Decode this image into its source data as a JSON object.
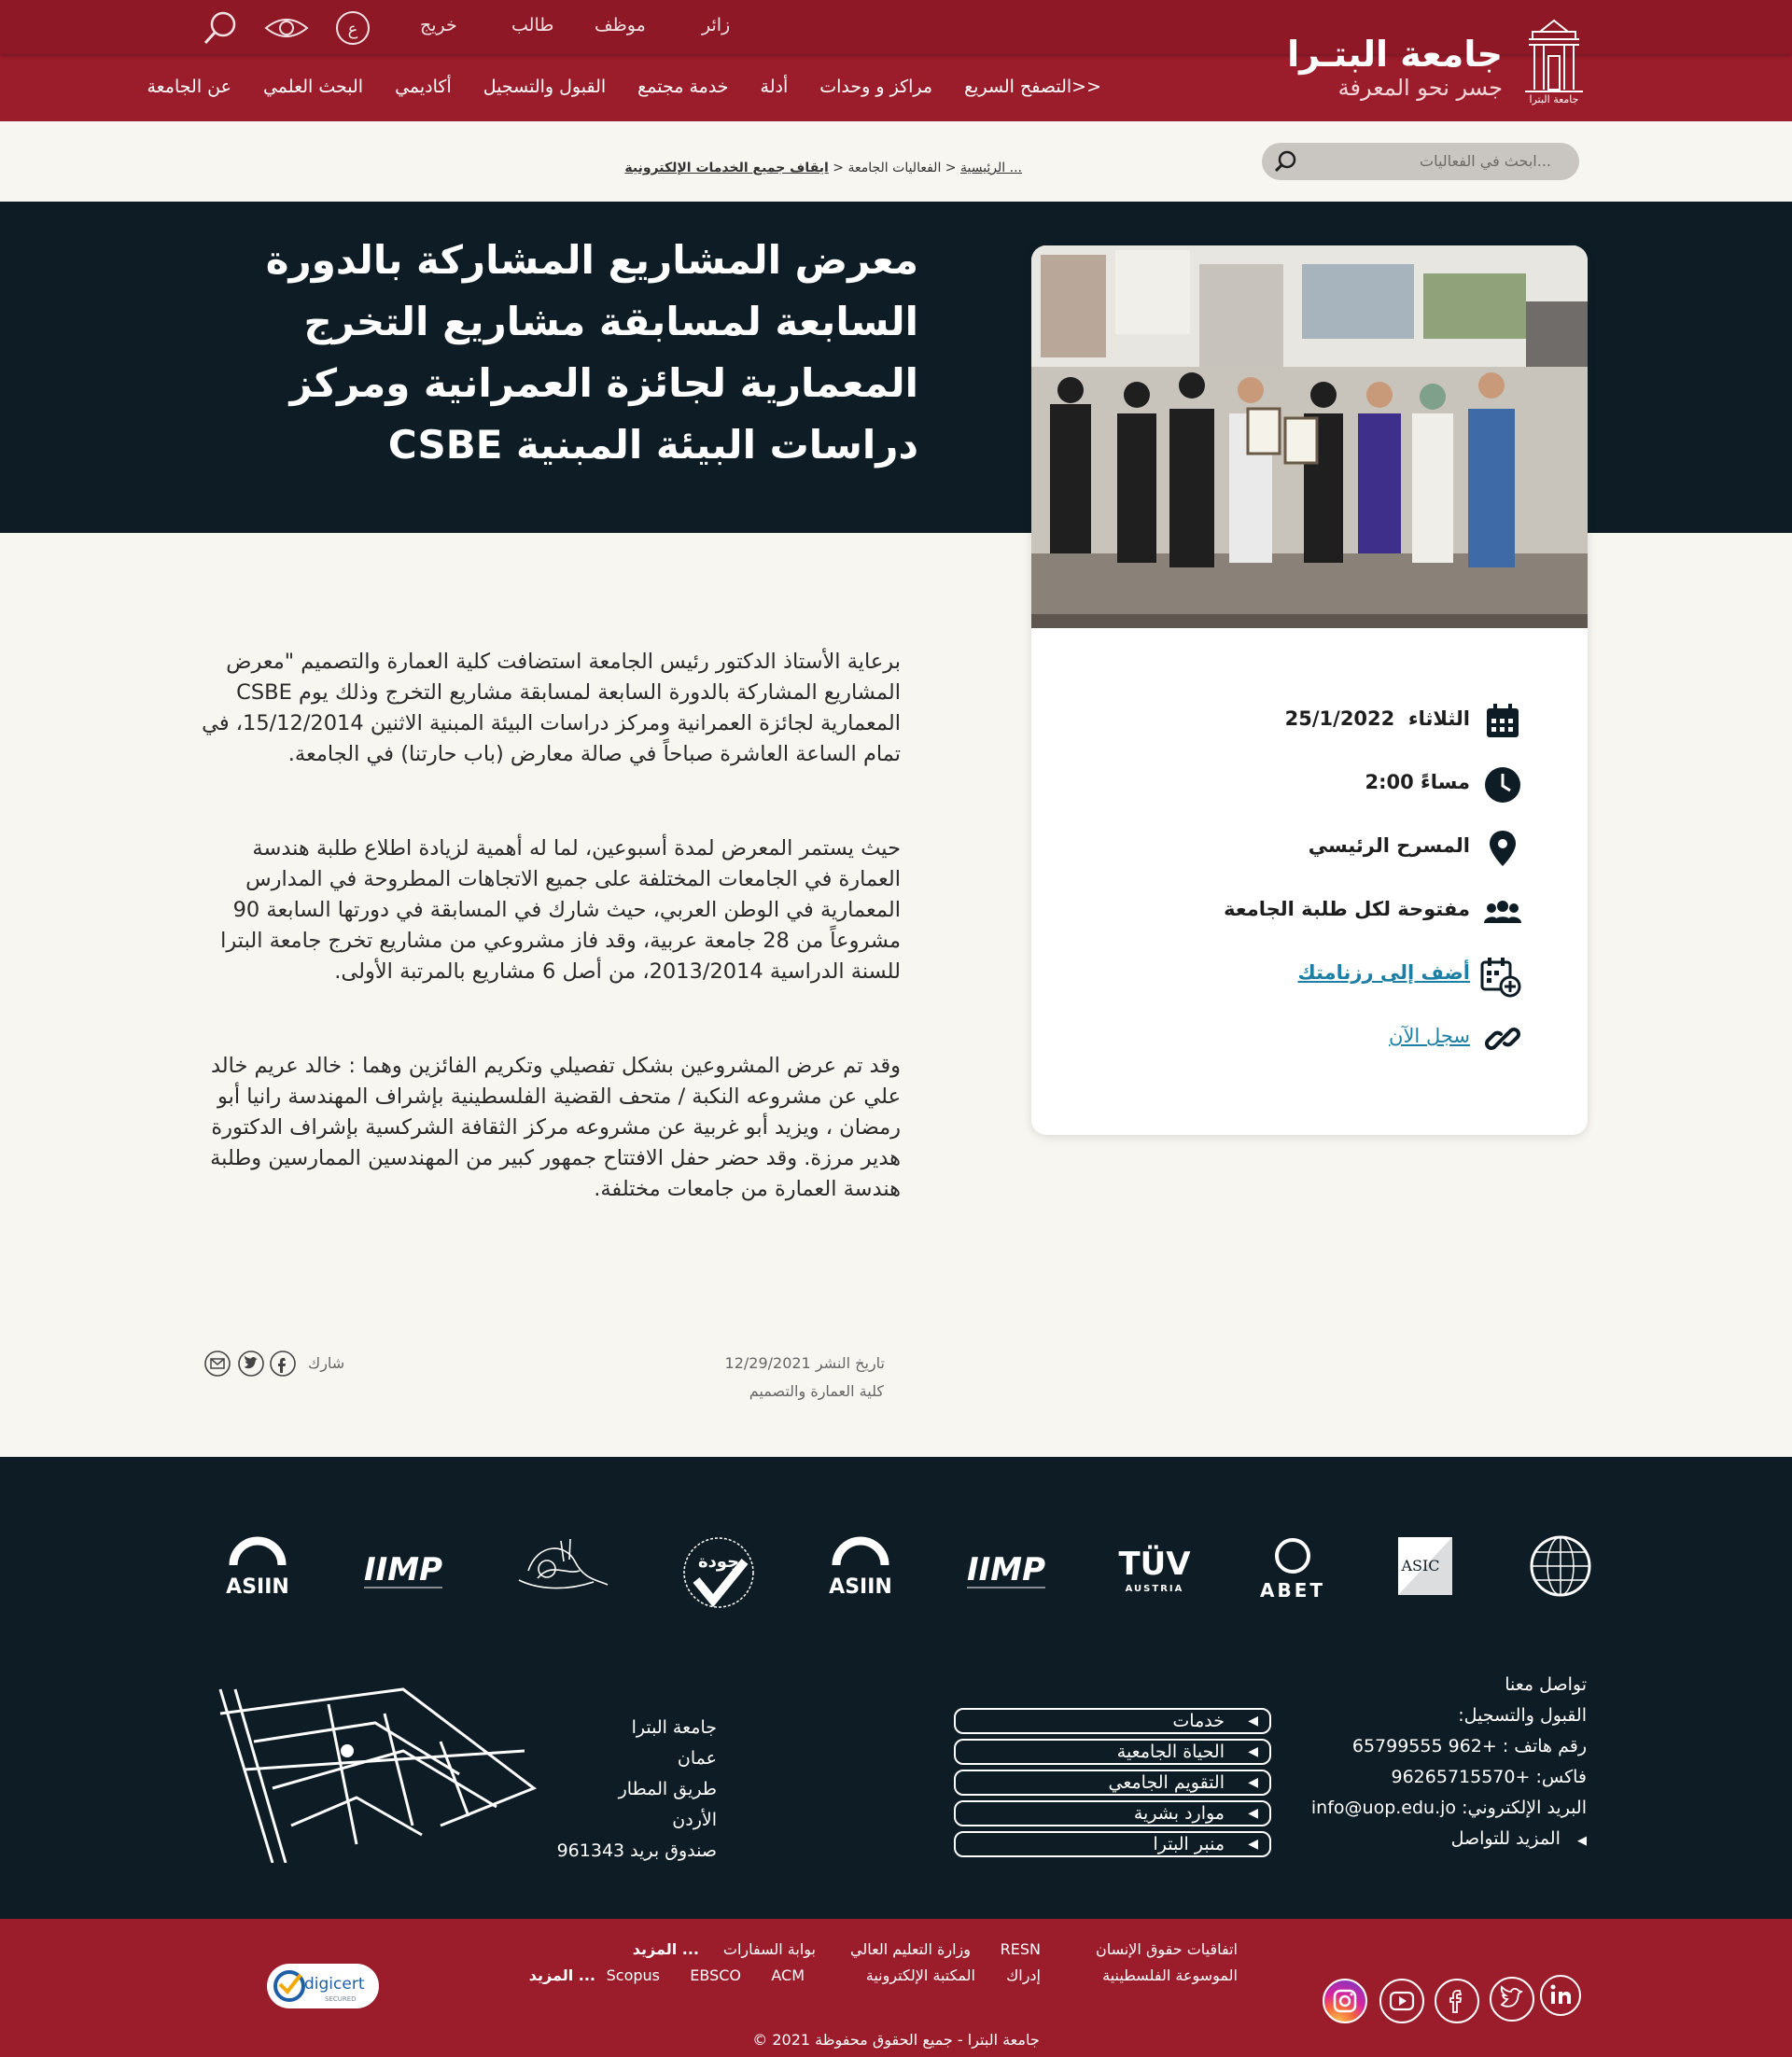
{
  "header": {
    "brand_title": "جامعة البتـرا",
    "brand_subtitle": "جسر نحو المعرفة",
    "logo_caption": "جامعة البترا",
    "top_links": [
      "زائر",
      "موظف",
      "طالب",
      "خريج"
    ],
    "lang_label": "ع",
    "main_nav": [
      "عن الجامعة",
      "البحث العلمي",
      "أكاديمي",
      "القبول والتسجيل",
      "خدمة مجتمع",
      "أدلة",
      "مراكز و وحدات",
      "<<التصفح السريع"
    ]
  },
  "search": {
    "placeholder": "...ابحث في الفعاليات"
  },
  "breadcrumb": {
    "home": "... الرئيسية",
    "sep1": " < ",
    "section": "الفعاليات الجامعة",
    "sep2": " < ",
    "current": "ايقاف جميع الخدمات الإلكترونية"
  },
  "event": {
    "title": "معرض المشاريع المشاركة بالدورة السابعة لمسابقة مشاريع التخرج المعمارية لجائزة العمرانية ومركز دراسات البيئة المبنية CSBE",
    "day": "الثلاثاء",
    "date": "25/1/2022",
    "time": "مساءً 2:00",
    "location": "المسرح الرئيسي",
    "audience": "مفتوحة لكل طلبة الجامعة",
    "add_calendar": "أضف إلى رزنامتك",
    "register": "سجل الآن"
  },
  "body": {
    "p1": "برعاية الأستاذ الدكتور رئيس الجامعة استضافت كلية العمارة والتصميم \"معرض المشاريع المشاركة بالدورة السابعة لمسابقة مشاريع التخرج وذلك يوم CSBE المعمارية لجائزة العمرانية ومركز دراسات البيئة المبنية الاثنين 15/12/2014، في تمام الساعة العاشرة صباحاً في صالة معارض (باب حارتنا) في الجامعة.",
    "p2": "حيث يستمر المعرض لمدة أسبوعين، لما له أهمية لزيادة اطلاع طلبة هندسة العمارة في الجامعات المختلفة على جميع الاتجاهات المطروحة في المدارس المعمارية في الوطن العربي، حيث شارك في المسابقة في دورتها السابعة 90 مشروعاً من 28 جامعة عربية، وقد فاز مشروعي من مشاريع تخرج جامعة البترا للسنة الدراسية 2013/2014، من أصل 6 مشاريع بالمرتبة الأولى.",
    "p3": "وقد تم عرض المشروعين بشكل تفصيلي وتكريم الفائزين وهما : خالد عريم خالد علي عن مشروعه النكبة / متحف القضية الفلسطينية بإشراف المهندسة رانيا أبو رمضان ، ويزيد أبو غربية عن مشروعه مركز الثقافة الشركسية بإشراف الدكتورة هدير مرزة. وقد حضر حفل الافتتاح جمهور كبير من المهندسين الممارسين وطلبة هندسة العمارة من جامعات مختلفة."
  },
  "meta": {
    "publish_label": "تاريخ النشر",
    "publish_date": "12/29/2021",
    "faculty": "كلية العمارة والتصميم",
    "share_label": "شارك"
  },
  "footer": {
    "accreditations": [
      "ASIIN",
      "IIMP",
      "ASIIN",
      "IIMP",
      "ABET",
      "ASIC",
      "TÜV"
    ],
    "tuv_sub": "AUSTRIA",
    "quality_label": "جودة",
    "address": [
      "جامعة البترا",
      "عمان",
      "طريق المطار",
      "الأردن",
      "صندوق بريد 961343"
    ],
    "quick_links": [
      "خدمات",
      "الحياة الجامعية",
      "التقويم الجامعي",
      "موارد بشرية",
      "منبر البترا"
    ],
    "contact": [
      "تواصل معنا",
      "القبول والتسجيل:",
      "رقم هاتف : +962 65799555",
      "فاكس: +96265715570",
      "البريد الإلكتروني: info@uop.edu.jo",
      "المزيد للتواصل"
    ]
  },
  "bottom": {
    "links_row1": [
      "اتفاقيات حقوق الإنسان",
      "RESN",
      "وزارة التعليم العالي",
      "بوابة السفارات",
      "... المزيد"
    ],
    "links_row2": [
      "الموسوعة الفلسطينية",
      "إدراك",
      "المكتبة الإلكترونية",
      "ACM",
      "EBSCO",
      "Scopus",
      "... المزيد"
    ],
    "copyright": "جامعة البترا - جميع الحقوق محفوظة 2021 ©",
    "digicert_label": "digicert",
    "digicert_sub": "SECURED"
  },
  "colors": {
    "brand": "#9b1c2a",
    "dark": "#0e1d25",
    "link": "#1d7fa3"
  }
}
